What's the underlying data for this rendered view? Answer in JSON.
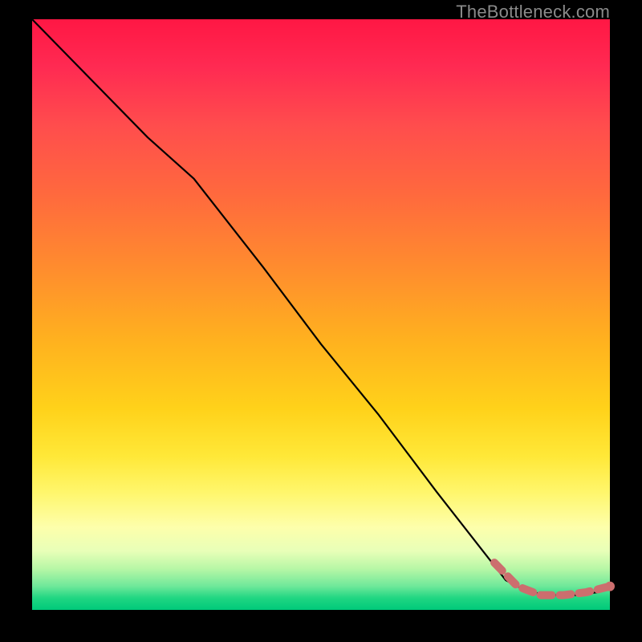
{
  "watermark": "TheBottleneck.com",
  "colors": {
    "curve": "#000000",
    "dashed": "#cc6e6e",
    "background_black": "#000000"
  },
  "chart_data": {
    "type": "line",
    "title": "",
    "xlabel": "",
    "ylabel": "",
    "xlim": [
      0,
      100
    ],
    "ylim": [
      0,
      100
    ],
    "grid": false,
    "legend": false,
    "series": [
      {
        "name": "main-curve",
        "style": "solid",
        "x": [
          0,
          10,
          20,
          28,
          40,
          50,
          60,
          70,
          78,
          82,
          86,
          90,
          94,
          98,
          100
        ],
        "y": [
          100,
          90,
          80,
          73,
          58,
          45,
          33,
          20,
          10,
          5,
          3,
          2.5,
          2.5,
          3,
          4
        ]
      },
      {
        "name": "highlight-segment",
        "style": "dashed",
        "x": [
          80,
          84,
          88,
          92,
          96,
          100
        ],
        "y": [
          8,
          4,
          2.5,
          2.5,
          3,
          4
        ]
      }
    ],
    "annotations": []
  }
}
